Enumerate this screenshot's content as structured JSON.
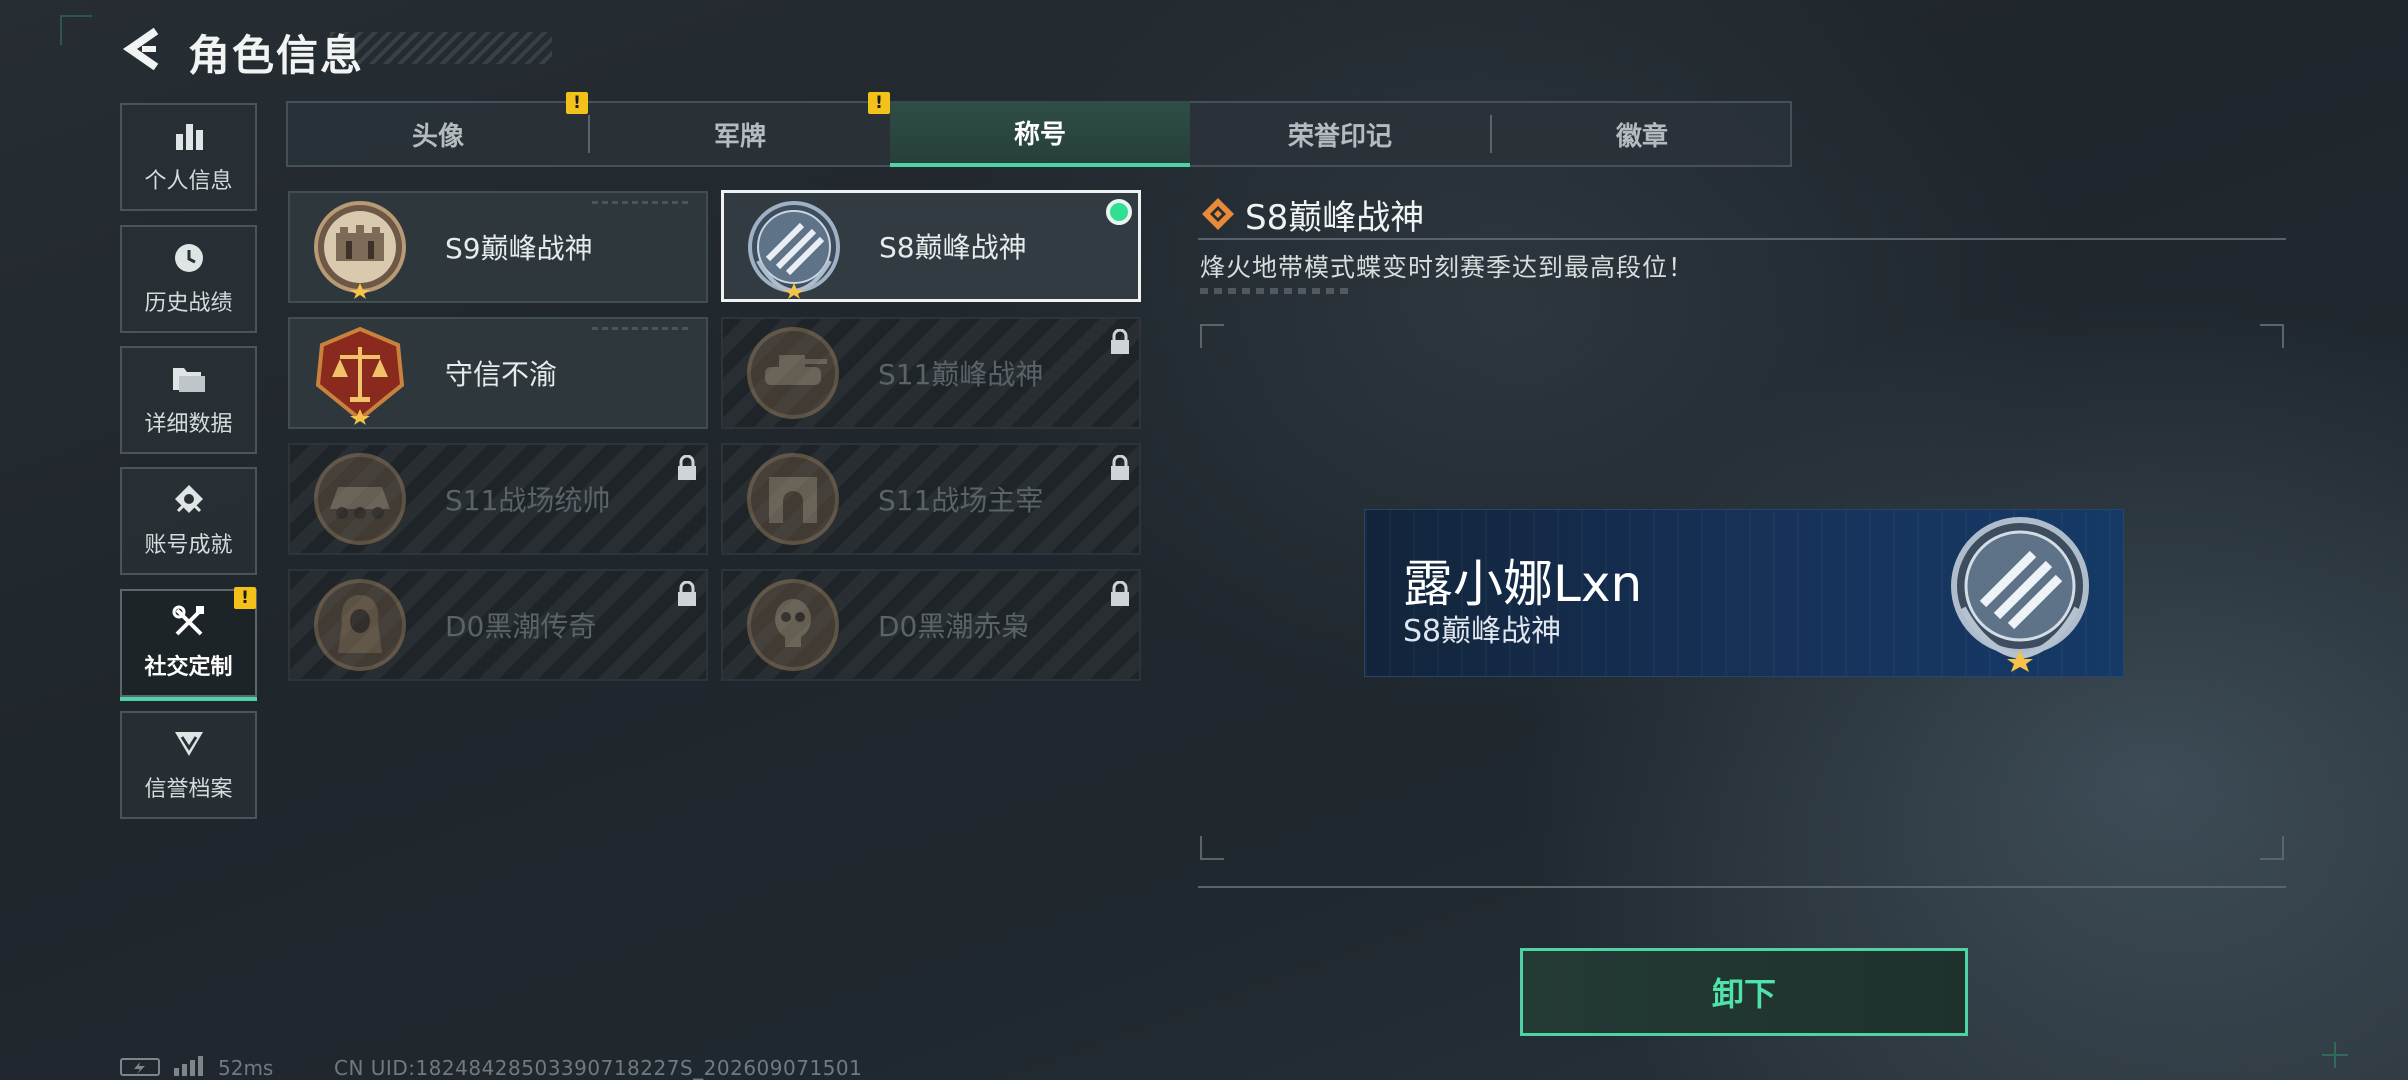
{
  "header": {
    "title": "角色信息"
  },
  "sidebar": {
    "items": [
      {
        "label": "个人信息"
      },
      {
        "label": "历史战绩"
      },
      {
        "label": "详细数据"
      },
      {
        "label": "账号成就"
      },
      {
        "label": "社交定制"
      },
      {
        "label": "信誉档案"
      }
    ],
    "active_index": 4
  },
  "tabs": [
    {
      "label": "头像"
    },
    {
      "label": "军牌"
    },
    {
      "label": "称号"
    },
    {
      "label": "荣誉印记"
    },
    {
      "label": "徽章"
    }
  ],
  "active_tab_index": 2,
  "warning_mark": "!",
  "titles": [
    {
      "name": "S9巅峰战神",
      "locked": false
    },
    {
      "name": "S8巅峰战神",
      "locked": false,
      "selected": true,
      "equipped": true
    },
    {
      "name": "守信不渝",
      "locked": false
    },
    {
      "name": "S11巅峰战神",
      "locked": true
    },
    {
      "name": "S11战场统帅",
      "locked": true
    },
    {
      "name": "S11战场主宰",
      "locked": true
    },
    {
      "name": "D0黑潮传奇",
      "locked": true
    },
    {
      "name": "D0黑潮赤枭",
      "locked": true
    }
  ],
  "detail": {
    "name": "S8巅峰战神",
    "description": "烽火地带模式蝶变时刻赛季达到最高段位！"
  },
  "preview": {
    "player_name": "露小娜Lxn",
    "title": "S8巅峰战神"
  },
  "action_button": {
    "label": "卸下"
  },
  "footer": {
    "ping": "52ms",
    "uid": "CN UID:18248428503390718227S_202609071501"
  },
  "colors": {
    "accent": "#4fd3a4",
    "warning": "#f2c21b",
    "equipped_dot": "#2ee08f",
    "banner_blue": "#16325a"
  },
  "icons": {
    "back": "chevron-left-icon",
    "sidebar": [
      "bar-chart-icon",
      "clock-icon",
      "folder-icon",
      "achievement-icon",
      "tools-icon",
      "shield-chevron-icon"
    ],
    "lock": "lock-icon",
    "diamond": "diamond-icon"
  }
}
